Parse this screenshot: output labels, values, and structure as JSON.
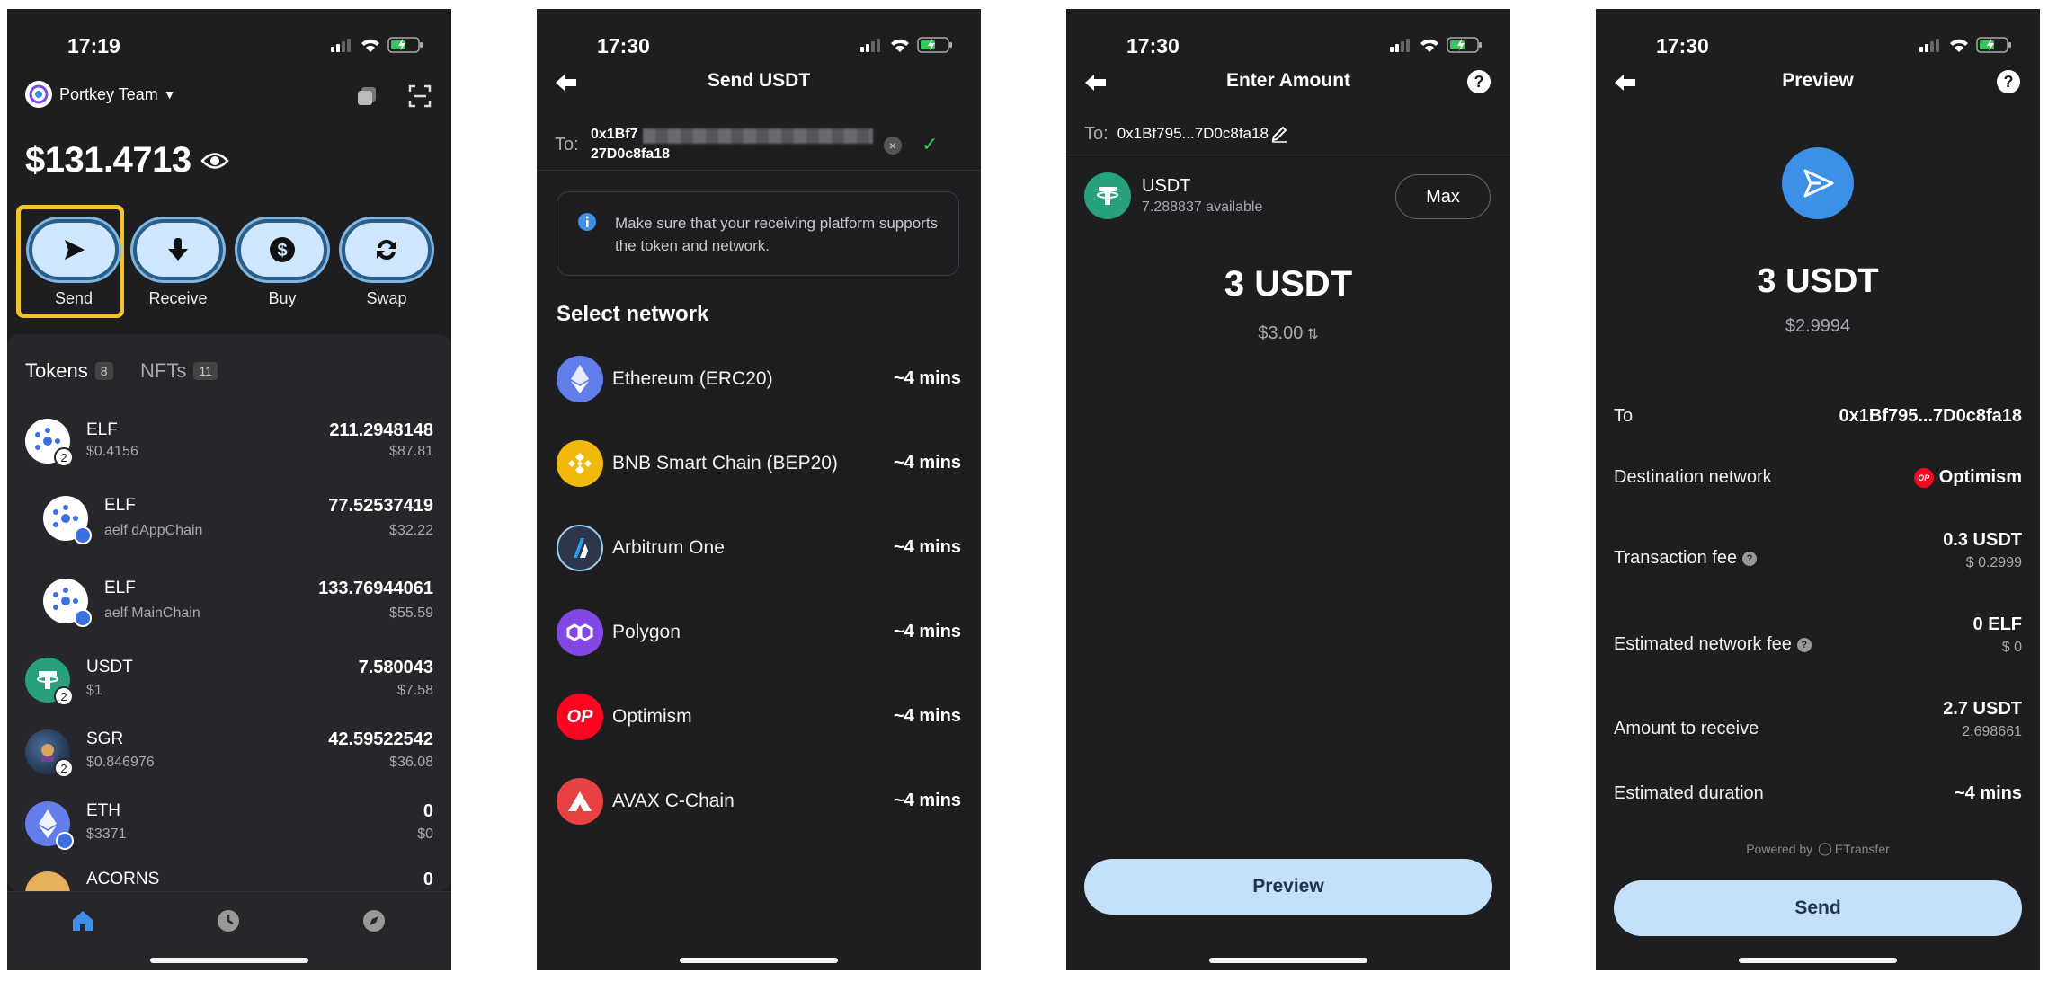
{
  "colors": {
    "accent": "#3c90e8",
    "button_bg": "#c4e0fb",
    "highlight": "#f4c430",
    "screen_bg": "#1e1e21",
    "panel_bg": "#27272b"
  },
  "screen1": {
    "time": "17:19",
    "account": "Portkey Team",
    "balance": "$131.4713",
    "actions": [
      {
        "label": "Send",
        "icon": "send-icon"
      },
      {
        "label": "Receive",
        "icon": "download-arrow-icon"
      },
      {
        "label": "Buy",
        "icon": "dollar-icon"
      },
      {
        "label": "Swap",
        "icon": "swap-icon"
      }
    ],
    "tabs": [
      {
        "label": "Tokens",
        "count": "8"
      },
      {
        "label": "NFTs",
        "count": "11"
      }
    ],
    "tokens": [
      {
        "name": "ELF",
        "sub": "$0.4156",
        "amount": "211.2948148",
        "usd": "$87.81",
        "badge": "2"
      },
      {
        "name": "ELF",
        "sub": "aelf dAppChain",
        "amount": "77.52537419",
        "usd": "$32.22"
      },
      {
        "name": "ELF",
        "sub": "aelf MainChain",
        "amount": "133.76944061",
        "usd": "$55.59"
      },
      {
        "name": "USDT",
        "sub": "$1",
        "amount": "7.580043",
        "usd": "$7.58",
        "badge": "2"
      },
      {
        "name": "SGR",
        "sub": "$0.846976",
        "amount": "42.59522542",
        "usd": "$36.08",
        "badge": "2"
      },
      {
        "name": "ETH",
        "sub": "$3371",
        "amount": "0",
        "usd": "$0"
      },
      {
        "name": "ACORNS",
        "sub": "",
        "amount": "0",
        "usd": ""
      }
    ]
  },
  "screen2": {
    "time": "17:30",
    "title": "Send USDT",
    "to_label": "To:",
    "address_line1": "0x1Bf7",
    "address_line2": "27D0c8fa18",
    "notice": "Make sure that your receiving platform supports the token and network.",
    "section": "Select network",
    "networks": [
      {
        "name": "Ethereum (ERC20)",
        "time": "~4 mins",
        "color": "#627eea"
      },
      {
        "name": "BNB Smart Chain (BEP20)",
        "time": "~4 mins",
        "color": "#f0b90b"
      },
      {
        "name": "Arbitrum One",
        "time": "~4 mins",
        "color": "#2d374b"
      },
      {
        "name": "Polygon",
        "time": "~4 mins",
        "color": "#8247e5"
      },
      {
        "name": "Optimism",
        "time": "~4 mins",
        "color": "#ff0420",
        "mark": "OP"
      },
      {
        "name": "AVAX C-Chain",
        "time": "~4 mins",
        "color": "#e84142"
      }
    ]
  },
  "screen3": {
    "time": "17:30",
    "title": "Enter Amount",
    "to_label": "To:",
    "address": "0x1Bf795...7D0c8fa18",
    "token": "USDT",
    "available": "7.288837 available",
    "max": "Max",
    "amount": "3 USDT",
    "fiat": "$3.00",
    "button": "Preview"
  },
  "screen4": {
    "time": "17:30",
    "title": "Preview",
    "amount": "3 USDT",
    "fiat": "$2.9994",
    "rows": [
      {
        "label": "To",
        "value": "0x1Bf795...7D0c8fa18"
      },
      {
        "label": "Destination network",
        "value": "Optimism",
        "mark": "OP"
      },
      {
        "label": "Transaction fee",
        "value": "0.3 USDT",
        "sub": "$ 0.2999"
      },
      {
        "label": "Estimated network fee",
        "value": "0 ELF",
        "sub": "$ 0"
      },
      {
        "label": "Amount to receive",
        "value": "2.7 USDT",
        "sub": "2.698661"
      },
      {
        "label": "Estimated duration",
        "value": "~4 mins"
      }
    ],
    "powered": "Powered by",
    "brand": "ETransfer",
    "button": "Send"
  }
}
